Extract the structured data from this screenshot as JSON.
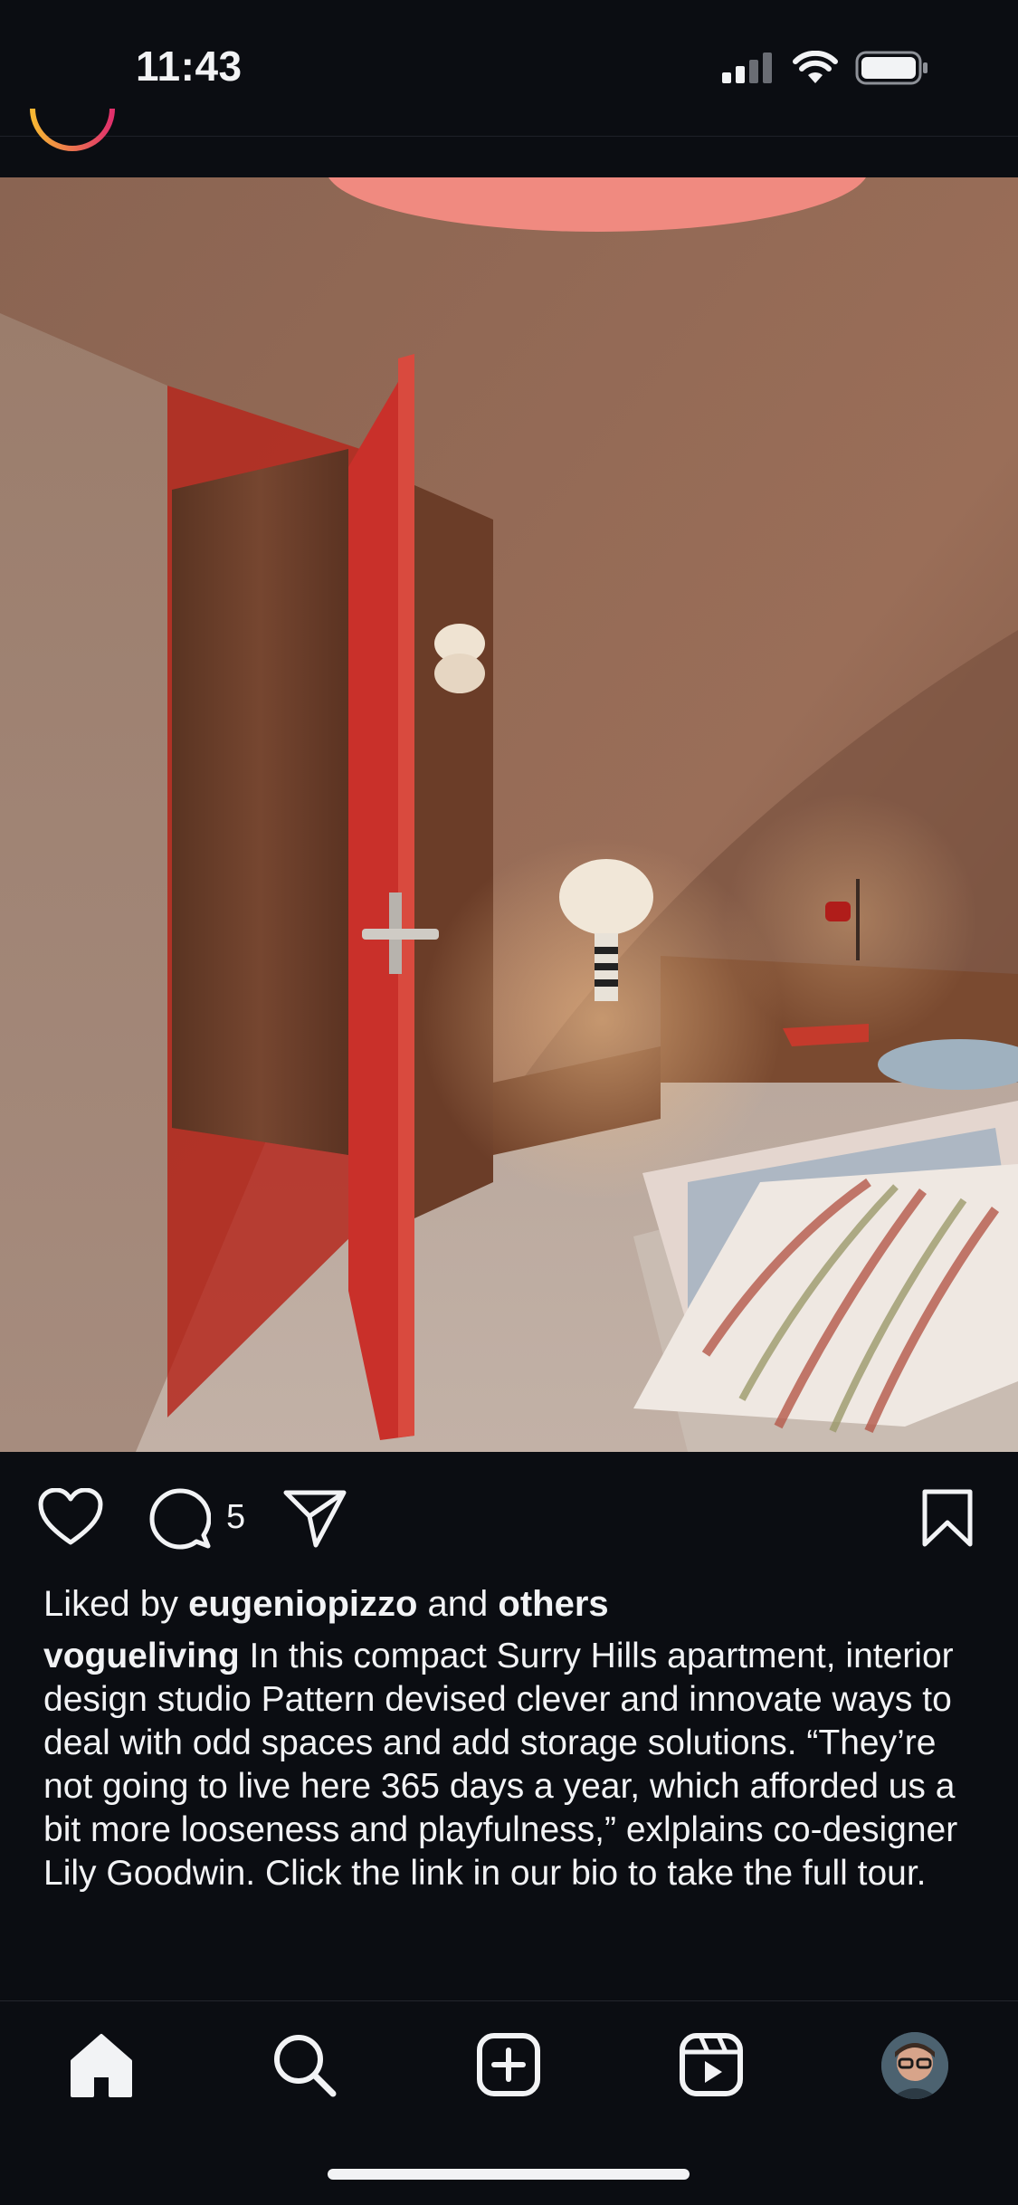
{
  "status_bar": {
    "time": "11:43"
  },
  "post": {
    "image_alt": "Bedroom with red door and vaulted cork ceiling",
    "comment_count": "5",
    "liked_by_prefix": "Liked by ",
    "liked_by_user": "eugeniopizzo",
    "liked_by_mid": " and ",
    "liked_by_others": "others",
    "caption_user": "vogueliving",
    "caption_text": " In this compact Surry Hills apartment, interior design studio Pattern devised clever and innovate ways to deal with odd spaces and add storage solutions. “They’re not going to live here 365 days a year, which afforded us a bit more looseness and playfulness,” exlplains co-designer Lily Goodwin. Click the link in our bio to take the full tour."
  },
  "actions": {
    "like": "heart-icon",
    "comment": "comment-icon",
    "share": "send-icon",
    "save": "bookmark-icon"
  },
  "nav": {
    "items": [
      "home-icon",
      "search-icon",
      "create-icon",
      "reels-icon",
      "profile-avatar"
    ]
  },
  "colors": {
    "background": "#0b0d12",
    "text": "#f2f3f5",
    "door_red": "#c9302a"
  }
}
